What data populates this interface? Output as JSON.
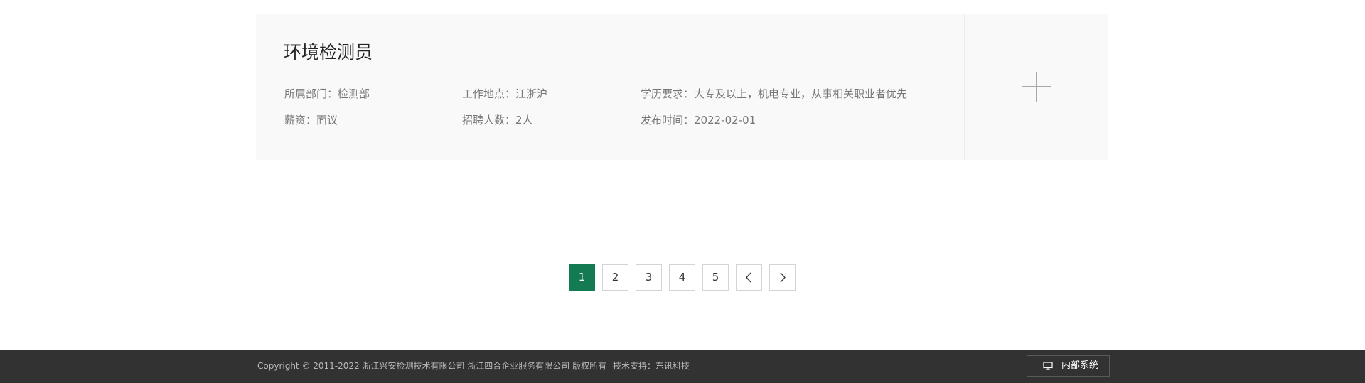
{
  "job": {
    "title": "环境检测员",
    "department": "所属部门：检测部",
    "location": "工作地点：江浙沪",
    "education": "学历要求：大专及以上，机电专业，从事相关职业者优先",
    "salary": "薪资：面议",
    "headcount": "招聘人数：2人",
    "publish_date": "发布时间：2022-02-01",
    "expand_icon": "plus-icon"
  },
  "pagination": {
    "pages": [
      "1",
      "2",
      "3",
      "4",
      "5"
    ],
    "active_page": "1",
    "prev_icon": "chevron-left-icon",
    "next_icon": "chevron-right-icon",
    "active_color": "#147a52"
  },
  "footer": {
    "copyright": "Copyright © 2011-2022 浙江兴安检测技术有限公司 浙江四合企业服务有限公司 版权所有",
    "support": "技术支持：东讯科技",
    "internal_button": "内部系统",
    "internal_icon": "monitor-icon",
    "background": "#323232"
  }
}
